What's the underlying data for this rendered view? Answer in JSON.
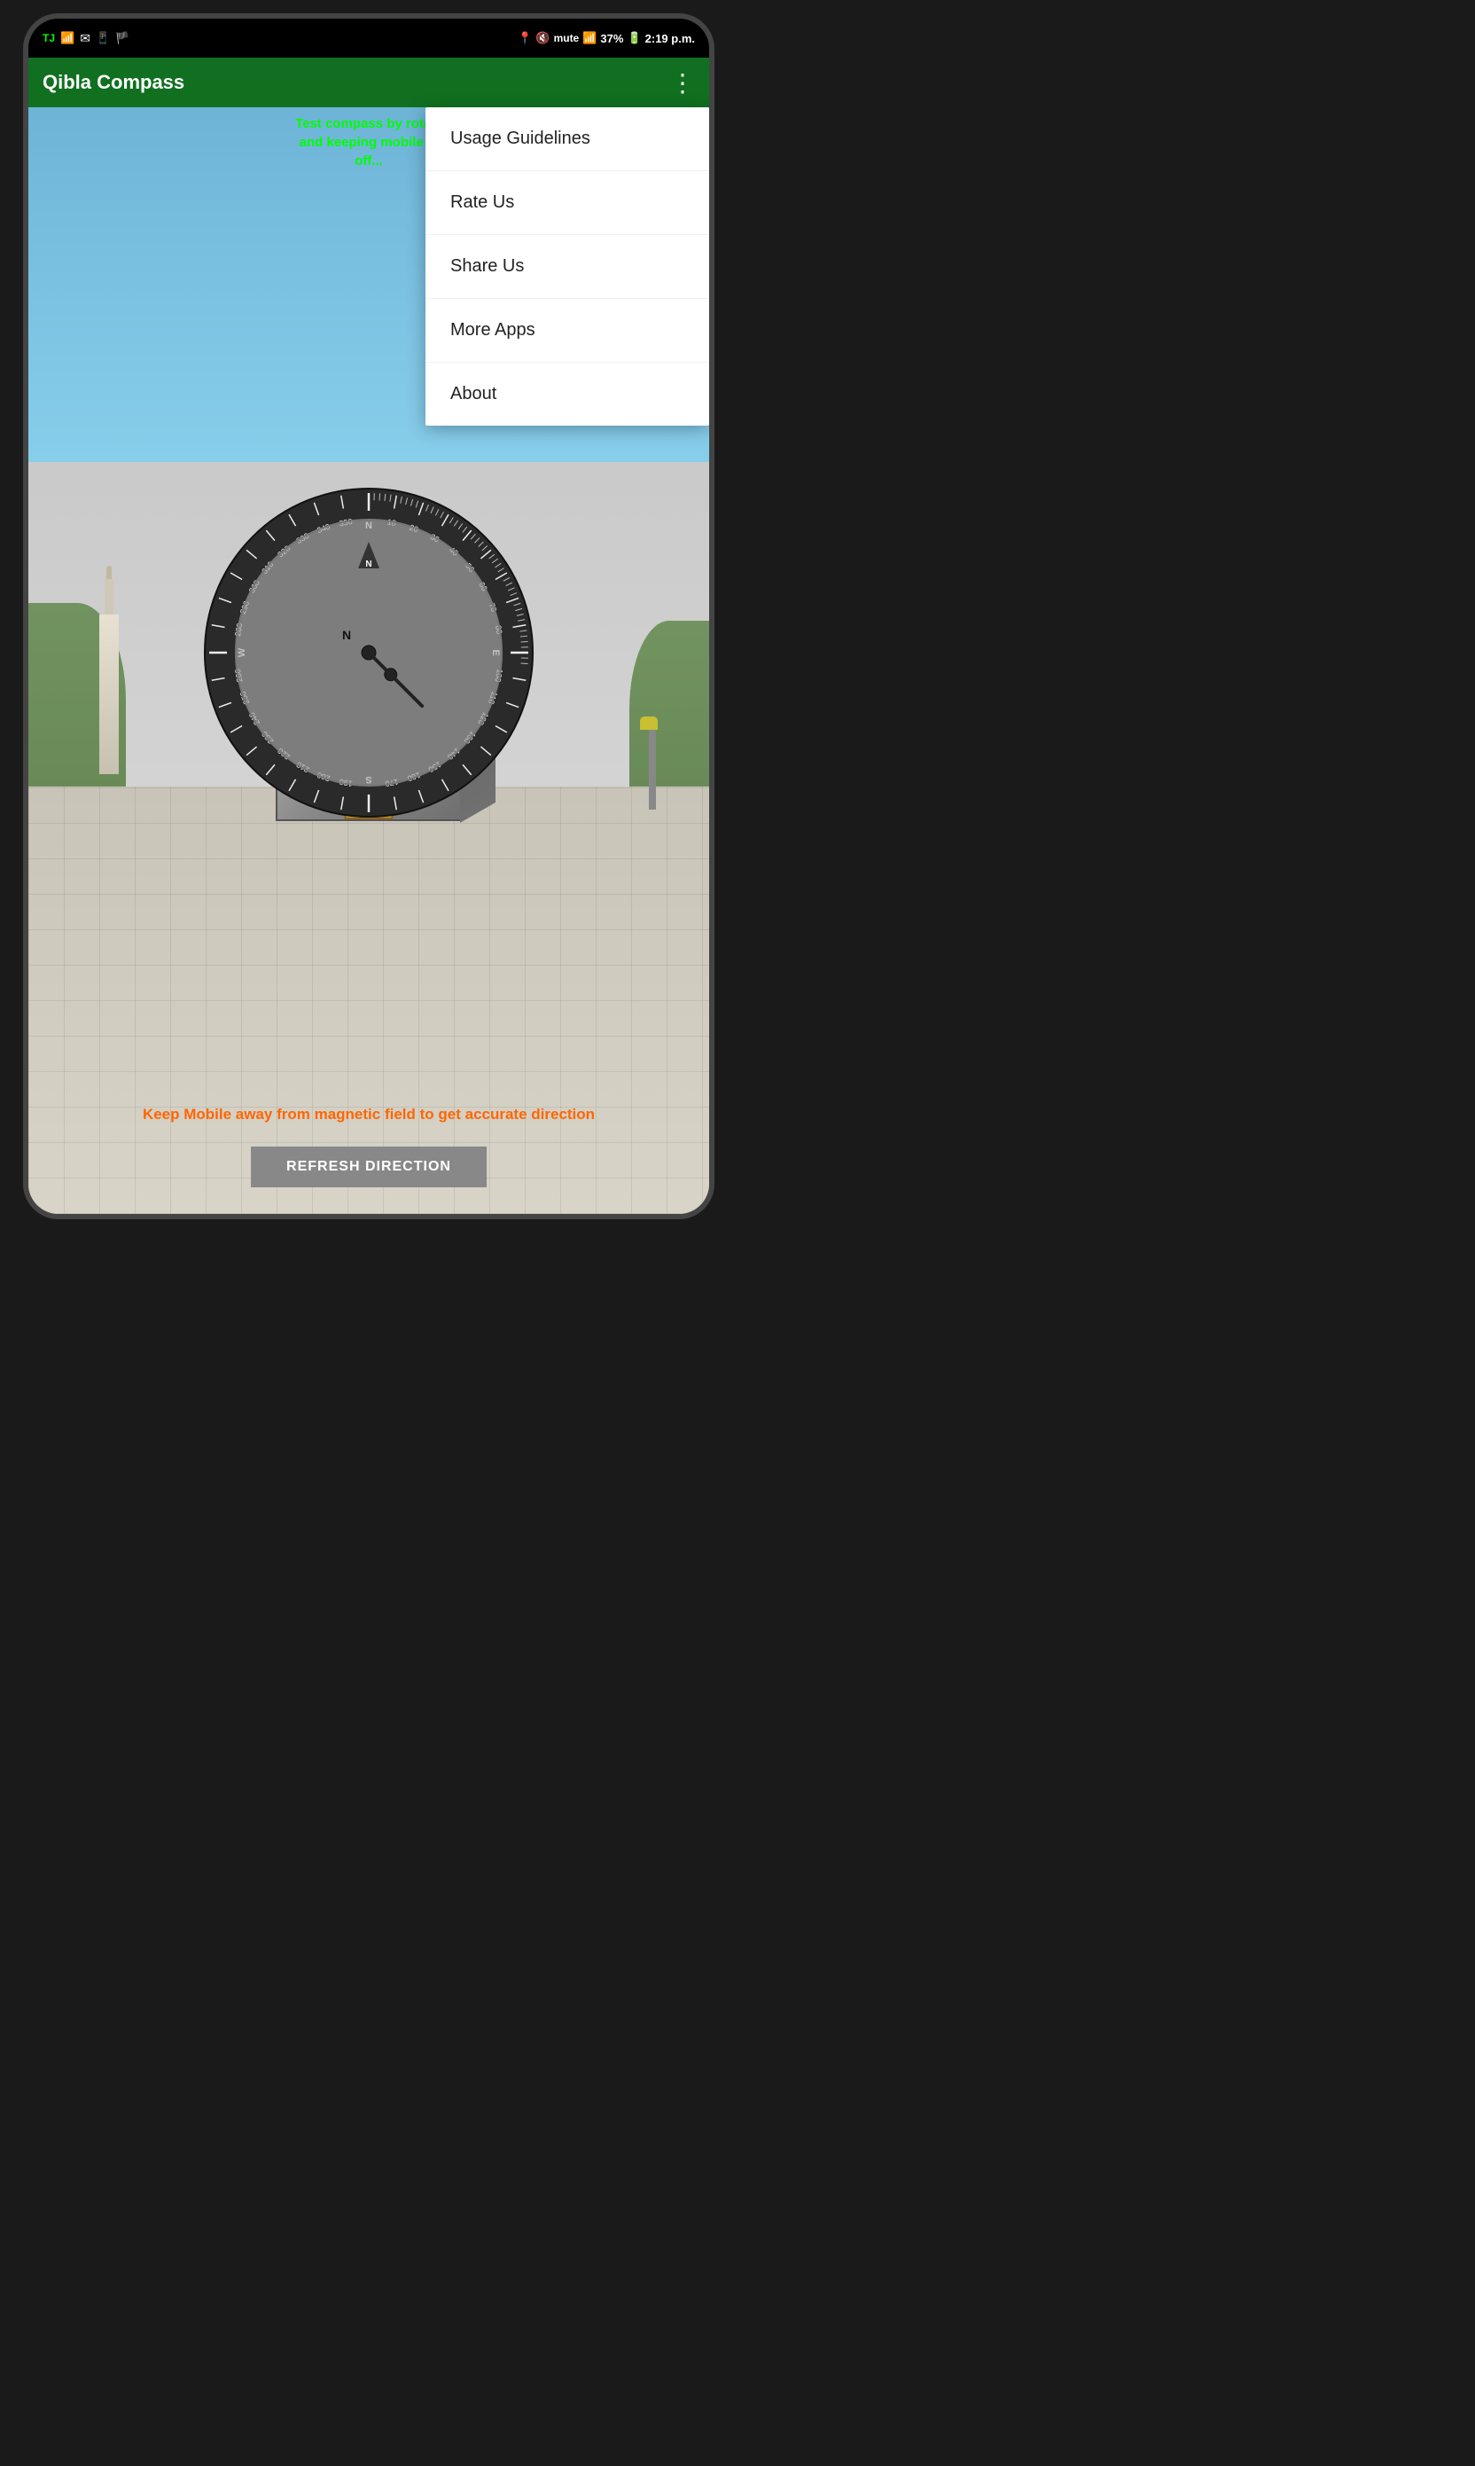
{
  "statusBar": {
    "leftIcons": [
      "TJ",
      "wifi",
      "mail",
      "whatsapp",
      "flag"
    ],
    "rightIcons": [
      "location",
      "mute",
      "4G",
      "signal",
      "battery"
    ],
    "batteryPercent": "37%",
    "time": "2:19 p.m."
  },
  "appBar": {
    "title": "Qibla Compass",
    "menuIcon": "⋮"
  },
  "instructionText": "Test compass by rota...\nand keeping mobile ...\noff...",
  "menu": {
    "items": [
      {
        "label": "Usage Guidelines"
      },
      {
        "label": "Rate Us"
      },
      {
        "label": "Share Us"
      },
      {
        "label": "More Apps"
      },
      {
        "label": "About"
      }
    ]
  },
  "compass": {
    "degrees": [
      "N",
      "10",
      "20",
      "30",
      "40",
      "50",
      "60",
      "E",
      "80",
      "90",
      "100",
      "S",
      "170",
      "180",
      "190",
      "200",
      "210",
      "220",
      "230",
      "240",
      "250",
      "260",
      "270",
      "280",
      "290",
      "300",
      "310",
      "320",
      "330",
      "340",
      "350"
    ]
  },
  "warningText": "Keep Mobile away from magnetic field to get accurate direction",
  "refreshButton": "REFRESH DIRECTION"
}
